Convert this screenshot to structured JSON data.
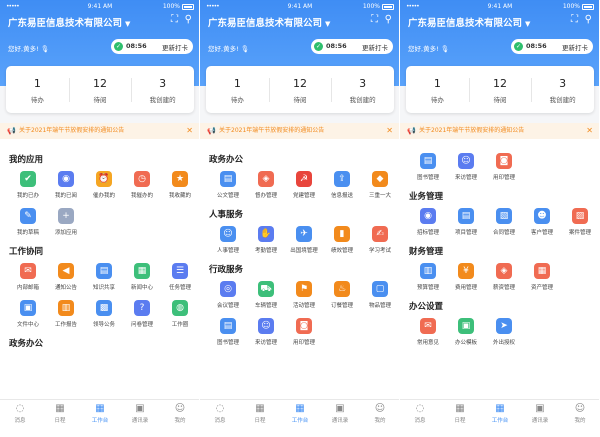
{
  "status_bar": {
    "time": "9:41 AM",
    "battery": "100%",
    "signal": "•••••"
  },
  "header": {
    "company": "广东易臣信息技术有限公司",
    "greeting": "您好,黄多!"
  },
  "clock_in": {
    "time": "08:56",
    "button": "更新打卡"
  },
  "stats": [
    {
      "value": "1",
      "label": "待办"
    },
    {
      "value": "12",
      "label": "待阅"
    },
    {
      "value": "3",
      "label": "我创建的"
    }
  ],
  "notice": "关于2021年端午节放假安排的通知公告",
  "tabs": [
    {
      "label": "消息",
      "icon": "chat-icon"
    },
    {
      "label": "日程",
      "icon": "calendar-icon"
    },
    {
      "label": "工作台",
      "icon": "grid-icon"
    },
    {
      "label": "通讯录",
      "icon": "contacts-icon"
    },
    {
      "label": "我的",
      "icon": "user-icon"
    }
  ],
  "screens": [
    {
      "sections": [
        {
          "title": "我的应用",
          "items": [
            {
              "label": "我的已办",
              "icon": "doc-check-icon",
              "color": "#3dbf7a"
            },
            {
              "label": "我的已阅",
              "icon": "read-icon",
              "color": "#5b7cf0"
            },
            {
              "label": "催办我的",
              "icon": "remind-icon",
              "color": "#f5a623"
            },
            {
              "label": "我催办的",
              "icon": "clock-icon",
              "color": "#f06b52"
            },
            {
              "label": "我收藏的",
              "icon": "star-icon",
              "color": "#f28a1c"
            },
            {
              "label": "我的草稿",
              "icon": "draft-icon",
              "color": "#4a8ff0"
            },
            {
              "label": "添加应用",
              "icon": "plus-icon",
              "color": "#9aa8c2"
            }
          ]
        },
        {
          "title": "工作协同",
          "items": [
            {
              "label": "内部邮箱",
              "icon": "mail-icon",
              "color": "#f06b52"
            },
            {
              "label": "通知公告",
              "icon": "megaphone-icon",
              "color": "#f28a1c"
            },
            {
              "label": "知识共享",
              "icon": "book-icon",
              "color": "#4a8ff0"
            },
            {
              "label": "新闻中心",
              "icon": "news-icon",
              "color": "#3dbf7a"
            },
            {
              "label": "任务管理",
              "icon": "task-icon",
              "color": "#5b7cf0"
            },
            {
              "label": "文件中心",
              "icon": "folder-icon",
              "color": "#4a8ff0"
            },
            {
              "label": "工作报告",
              "icon": "report-icon",
              "color": "#f28a1c"
            },
            {
              "label": "领导公务",
              "icon": "briefcase-icon",
              "color": "#4a8ff0"
            },
            {
              "label": "问卷管理",
              "icon": "survey-icon",
              "color": "#5b7cf0"
            },
            {
              "label": "工作圈",
              "icon": "circle-icon",
              "color": "#3dbf7a"
            }
          ]
        },
        {
          "title": "政务办公",
          "items": []
        }
      ]
    },
    {
      "sections": [
        {
          "title": "政务办公",
          "items": [
            {
              "label": "公文管理",
              "icon": "document-icon",
              "color": "#4a8ff0"
            },
            {
              "label": "督办管理",
              "icon": "supervise-icon",
              "color": "#f06b52"
            },
            {
              "label": "党建管理",
              "icon": "party-icon",
              "color": "#e8453c"
            },
            {
              "label": "信息报送",
              "icon": "submit-icon",
              "color": "#4a8ff0"
            },
            {
              "label": "三重一大",
              "icon": "decision-icon",
              "color": "#f28a1c"
            }
          ]
        },
        {
          "title": "人事服务",
          "items": [
            {
              "label": "人事管理",
              "icon": "person-icon",
              "color": "#4a8ff0"
            },
            {
              "label": "考勤管理",
              "icon": "attendance-icon",
              "color": "#5b7cf0"
            },
            {
              "label": "出国境管理",
              "icon": "plane-icon",
              "color": "#4a8ff0"
            },
            {
              "label": "绩效管理",
              "icon": "chart-icon",
              "color": "#f28a1c"
            },
            {
              "label": "学习考试",
              "icon": "exam-icon",
              "color": "#f06b52"
            }
          ]
        },
        {
          "title": "行政服务",
          "items": [
            {
              "label": "会议管理",
              "icon": "meeting-icon",
              "color": "#5b7cf0"
            },
            {
              "label": "车辆管理",
              "icon": "car-icon",
              "color": "#3dbf7a"
            },
            {
              "label": "活动管理",
              "icon": "flag-icon",
              "color": "#f28a1c"
            },
            {
              "label": "订餐管理",
              "icon": "food-icon",
              "color": "#f28a1c"
            },
            {
              "label": "物品管理",
              "icon": "box-icon",
              "color": "#4a8ff0"
            },
            {
              "label": "图书管理",
              "icon": "book-icon",
              "color": "#4a8ff0"
            },
            {
              "label": "来访管理",
              "icon": "visitor-icon",
              "color": "#5b7cf0"
            },
            {
              "label": "用印管理",
              "icon": "seal-icon",
              "color": "#f06b52"
            }
          ]
        }
      ]
    },
    {
      "sections": [
        {
          "title": "",
          "items": [
            {
              "label": "图书管理",
              "icon": "book-icon",
              "color": "#4a8ff0"
            },
            {
              "label": "来访管理",
              "icon": "visitor-icon",
              "color": "#5b7cf0"
            },
            {
              "label": "用印管理",
              "icon": "seal-icon",
              "color": "#f06b52"
            }
          ]
        },
        {
          "title": "业务管理",
          "items": [
            {
              "label": "招标管理",
              "icon": "bid-icon",
              "color": "#5b7cf0"
            },
            {
              "label": "项目管理",
              "icon": "project-icon",
              "color": "#4a8ff0"
            },
            {
              "label": "合同管理",
              "icon": "contract-icon",
              "color": "#4a8ff0"
            },
            {
              "label": "客户管理",
              "icon": "customer-icon",
              "color": "#4a8ff0"
            },
            {
              "label": "案件管理",
              "icon": "case-icon",
              "color": "#f06b52"
            }
          ]
        },
        {
          "title": "财务管理",
          "items": [
            {
              "label": "预算管理",
              "icon": "budget-icon",
              "color": "#4a8ff0"
            },
            {
              "label": "费用管理",
              "icon": "expense-icon",
              "color": "#f28a1c"
            },
            {
              "label": "薪资管理",
              "icon": "salary-icon",
              "color": "#f06b52"
            },
            {
              "label": "资产管理",
              "icon": "asset-icon",
              "color": "#f06b52"
            }
          ]
        },
        {
          "title": "办公设置",
          "items": [
            {
              "label": "常用意见",
              "icon": "opinion-icon",
              "color": "#f06b52"
            },
            {
              "label": "办公模板",
              "icon": "template-icon",
              "color": "#3dbf7a"
            },
            {
              "label": "外出授权",
              "icon": "outing-icon",
              "color": "#4a8ff0"
            }
          ]
        }
      ]
    }
  ]
}
